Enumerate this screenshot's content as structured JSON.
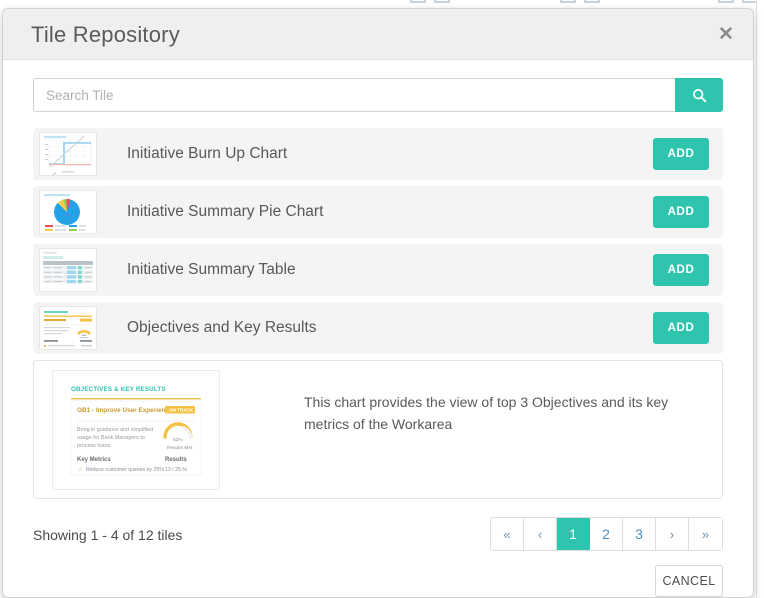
{
  "modal": {
    "title": "Tile Repository",
    "close_icon": "close-icon"
  },
  "search": {
    "placeholder": "Search Tile",
    "value": "",
    "button_icon": "search-icon"
  },
  "tiles": [
    {
      "name": "Initiative Burn Up Chart",
      "add_label": "ADD",
      "thumb": "burn-up-chart-thumbnail"
    },
    {
      "name": "Initiative Summary Pie Chart",
      "add_label": "ADD",
      "thumb": "pie-chart-thumbnail"
    },
    {
      "name": "Initiative Summary Table",
      "add_label": "ADD",
      "thumb": "table-thumbnail"
    },
    {
      "name": "Objectives and Key Results",
      "add_label": "ADD",
      "thumb": "okr-thumbnail"
    }
  ],
  "preview": {
    "description": "This chart provides the view of top 3 Objectives and its key metrics of the Workarea",
    "image": {
      "heading": "OBJECTIVES & KEY RESULTS",
      "objective_title": "OB1 - Improve User Experience",
      "status_badge": "ON TRACK",
      "objective_description": "Bring in guidance and simplified usage for Bank Managers to process loans.",
      "gauge_value": "52%",
      "gauge_label": "Results Met",
      "metrics_header": "Key Metrics",
      "results_header": "Results",
      "metric_row_label": "Reduce customer queries by 25%",
      "metric_row_value": "13 / 25 %"
    }
  },
  "footer": {
    "showing_text": "Showing 1 - 4 of 12 tiles",
    "pagination": [
      {
        "label": "«",
        "active": false,
        "kind": "arrow"
      },
      {
        "label": "‹",
        "active": false,
        "kind": "arrow"
      },
      {
        "label": "1",
        "active": true,
        "kind": "page"
      },
      {
        "label": "2",
        "active": false,
        "kind": "page"
      },
      {
        "label": "3",
        "active": false,
        "kind": "page"
      },
      {
        "label": "›",
        "active": false,
        "kind": "arrow"
      },
      {
        "label": "»",
        "active": false,
        "kind": "arrow"
      }
    ],
    "cancel_label": "CANCEL"
  },
  "colors": {
    "accent_teal": "#2ec4ad",
    "header_bg": "#efefef",
    "row_bg": "#f4f4f4",
    "link_blue": "#4a90c4",
    "okr_yellow": "#f5c344",
    "okr_teal_text": "#2ec4ad"
  }
}
